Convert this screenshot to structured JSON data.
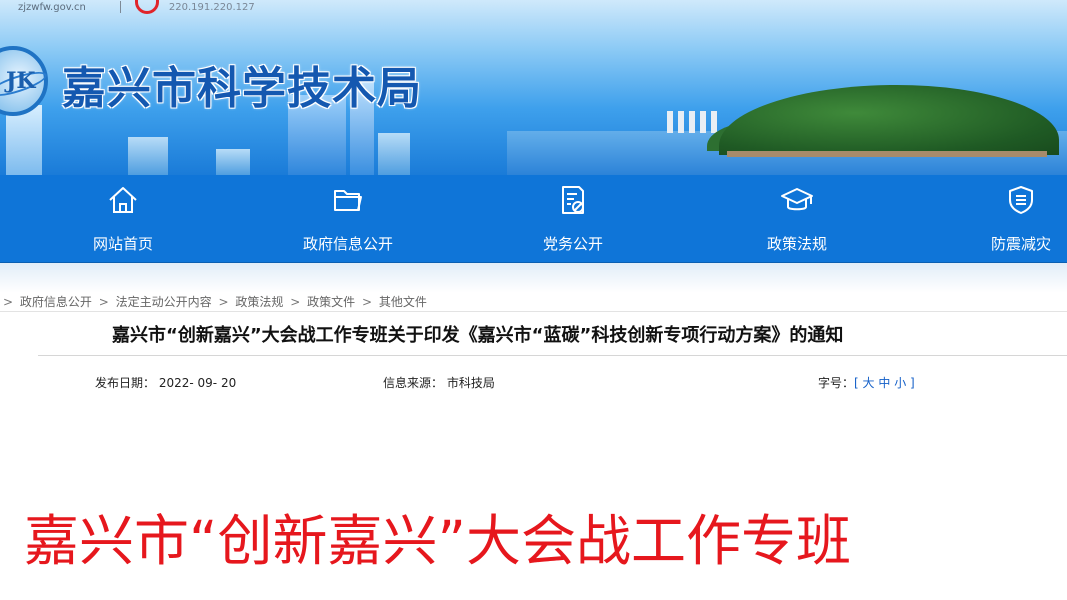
{
  "header": {
    "domain": "zjzwfw.gov.cn",
    "ip": "220.191.220.127",
    "site_title": "嘉兴市科学技术局",
    "logo_text": "JK"
  },
  "nav": {
    "items": [
      {
        "label": "网站首页",
        "icon": "home-icon"
      },
      {
        "label": "政府信息公开",
        "icon": "folder-icon"
      },
      {
        "label": "党务公开",
        "icon": "party-document-icon"
      },
      {
        "label": "政策法规",
        "icon": "graduation-cap-icon"
      },
      {
        "label": "防震减灾",
        "icon": "shield-icon"
      }
    ]
  },
  "breadcrumb": {
    "items": [
      "政府信息公开",
      "法定主动公开内容",
      "政策法规",
      "政策文件",
      "其他文件"
    ],
    "separator": ">"
  },
  "article": {
    "title": "嘉兴市“创新嘉兴”大会战工作专班关于印发《嘉兴市“蓝碳”科技创新专项行动方案》的通知",
    "date_label": "发布日期：",
    "date_value": "2022- 09- 20",
    "source_label": "信息来源：",
    "source_value": "市科技局",
    "fontsize_label": "字号：",
    "fontsize_options": [
      "大",
      "中",
      "小"
    ]
  },
  "overlay": {
    "caption": "嘉兴市“创新嘉兴”大会战工作专班",
    "color": "#e6171d"
  },
  "colors": {
    "nav_bg": "#0f75d8",
    "title_blue": "#1458b0",
    "link_blue": "#1560c8"
  }
}
